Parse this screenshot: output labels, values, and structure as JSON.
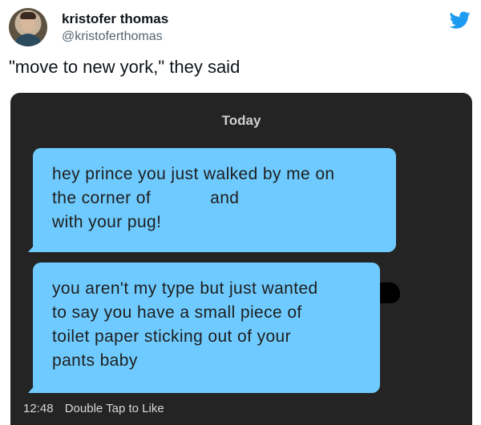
{
  "tweet": {
    "display_name": "kristofer thomas",
    "handle": "@kristoferthomas",
    "text": "\"move to new york,\" they said",
    "brand_icon": "twitter-bird-icon",
    "brand_color": "#1d9bf0"
  },
  "chat": {
    "date_label": "Today",
    "bubble_color": "#6fcbff",
    "messages": [
      {
        "lines": [
          "hey prince you just walked by me on",
          "the corner of",
          "and",
          "with your pug!"
        ]
      },
      {
        "lines": [
          "you aren't my type but just wanted",
          "to say you have a small piece of",
          "toilet paper sticking out of your",
          "pants baby"
        ]
      }
    ],
    "timestamp": "12:48",
    "footer_hint": "Double Tap to Like"
  }
}
